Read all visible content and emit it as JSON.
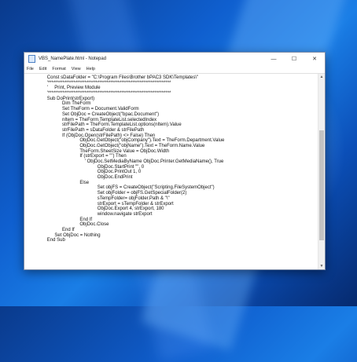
{
  "window": {
    "title": "VBS_NamePlate.html - Notepad",
    "minimize_glyph": "—",
    "maximize_glyph": "☐",
    "close_glyph": "✕"
  },
  "menu": [
    "File",
    "Edit",
    "Format",
    "View",
    "Help"
  ],
  "lines": [
    {
      "indent": 9,
      "text": "Const sDataFolder = \"C:\\Program Files\\Brother bPAC3 SDK\\Templates\\\""
    },
    {
      "indent": 9,
      "text": "'*******************************************************************"
    },
    {
      "indent": 9,
      "text": "'     Print, Preview Module"
    },
    {
      "indent": 9,
      "text": "'*******************************************************************"
    },
    {
      "indent": 9,
      "text": "Sub DoPrint(strExport)"
    },
    {
      "indent": 15,
      "text": "Dim TheForm"
    },
    {
      "indent": 15,
      "text": "Set TheForm = Document.ValidForm"
    },
    {
      "indent": 15,
      "text": "Set ObjDoc = CreateObject(\"bpac.Document\")"
    },
    {
      "indent": 15,
      "text": "nItem = TheForm.TemplateList.selectedIndex"
    },
    {
      "indent": 15,
      "text": "strFilePath = TheForm.TemplateList.options(nItem).Value"
    },
    {
      "indent": 15,
      "text": "strFilePath = sDataFolder & strFilePath"
    },
    {
      "indent": 15,
      "text": "If (ObjDoc.Open(strFilePath) <> False) Then"
    },
    {
      "indent": 22,
      "text": "ObjDoc.GetObject(\"objCompany\").Text = TheForm.Department.Value"
    },
    {
      "indent": 22,
      "text": "ObjDoc.GetObject(\"objName\").Text = TheForm.Name.Value"
    },
    {
      "indent": 22,
      "text": "TheForm.SheetSize Value = ObjDoc.Width"
    },
    {
      "indent": 22,
      "text": "If (strExport = \"\") Then"
    },
    {
      "indent": 24,
      "text": "' ObjDoc.SetMediaByName ObjDoc.Printer.GetMediaName(), True"
    },
    {
      "indent": 29,
      "text": "ObjDoc.StartPrint \"\", 0"
    },
    {
      "indent": 29,
      "text": "ObjDoc.PrintOut 1, 0"
    },
    {
      "indent": 29,
      "text": "ObjDoc.EndPrint"
    },
    {
      "indent": 22,
      "text": "Else"
    },
    {
      "indent": 29,
      "text": "Set objFS = CreateObject(\"Scripting.FileSystemObject\")"
    },
    {
      "indent": 29,
      "text": "Set objFolder = objFS.GetSpecialFolder(2)"
    },
    {
      "indent": 29,
      "text": "sTempFolder= objFolder.Path & \"\\\""
    },
    {
      "indent": 29,
      "text": "strExport = sTempFolder & strExport"
    },
    {
      "indent": 29,
      "text": "ObjDoc.Export 4, strExport, 180"
    },
    {
      "indent": 29,
      "text": "window.navigate strExport"
    },
    {
      "indent": 22,
      "text": "End If"
    },
    {
      "indent": 22,
      "text": "ObjDoc.Close"
    },
    {
      "indent": 15,
      "text": "End If"
    },
    {
      "indent": 12,
      "text": "Set ObjDoc = Nothing"
    },
    {
      "indent": 9,
      "text": "End Sub"
    }
  ],
  "scrollbar": {
    "up_glyph": "▲",
    "down_glyph": "▼"
  }
}
